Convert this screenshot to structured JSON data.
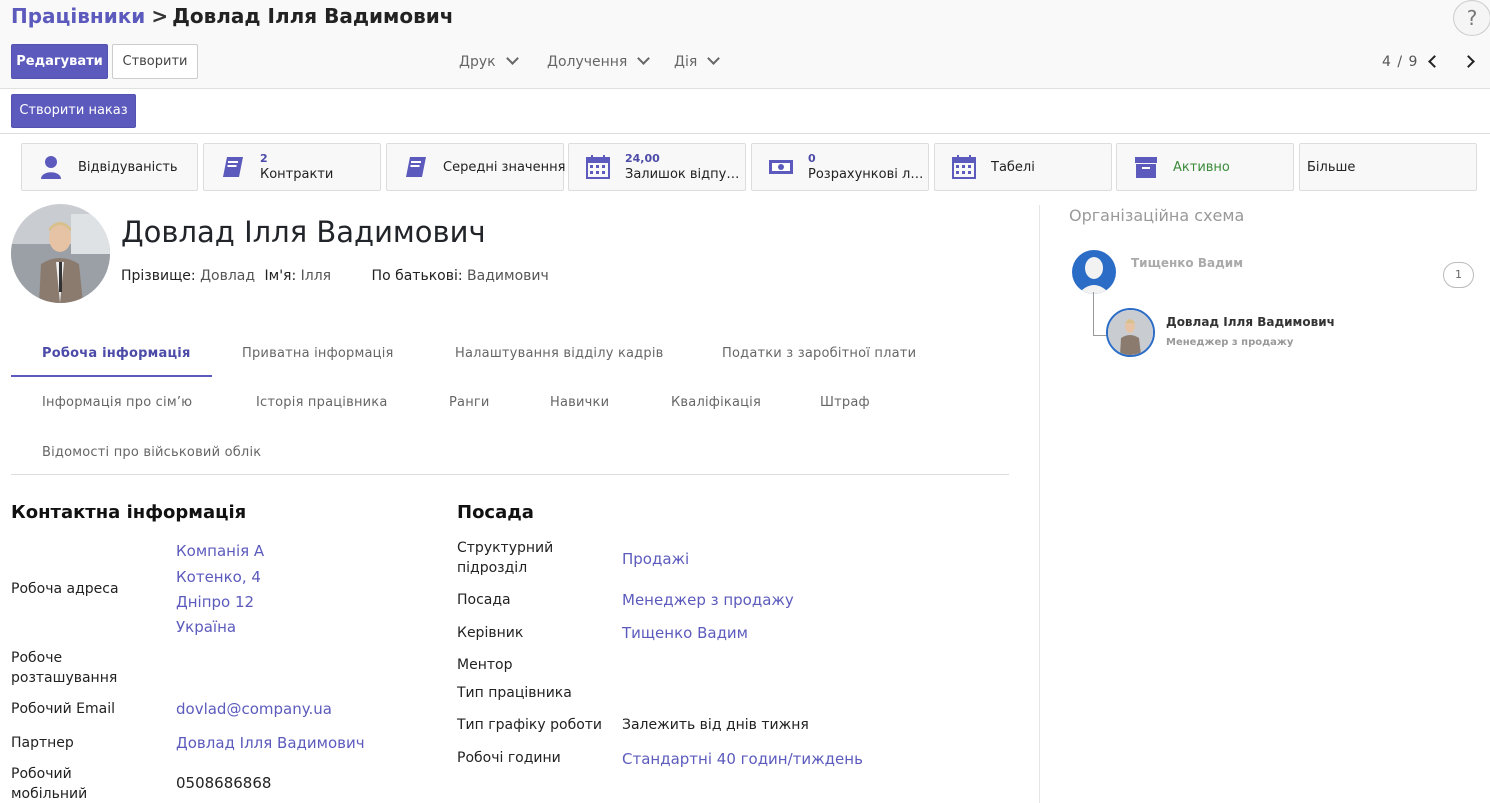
{
  "breadcrumb": {
    "parent": "Працівники",
    "separator": ">",
    "current": "Довлад Ілля Вадимович"
  },
  "help_label": "?",
  "toolbar": {
    "edit_label": "Редагувати",
    "create_label": "Створити",
    "print_label": "Друк",
    "attach_label": "Долучення",
    "action_label": "Дія"
  },
  "pager": {
    "value": "4 / 9"
  },
  "statusbar": {
    "create_order_label": "Створити наказ"
  },
  "smart_buttons": [
    {
      "label": "Відвідуваність",
      "icon": "user-icon"
    },
    {
      "count": "2",
      "label": "Контракти",
      "icon": "book-icon"
    },
    {
      "label": "Середні значення",
      "icon": "book-icon"
    },
    {
      "count": "24,00",
      "label": "Залишок відпуст…",
      "icon": "calendar-icon"
    },
    {
      "count": "0",
      "label": "Розрахункові ли…",
      "icon": "money-icon"
    },
    {
      "label": "Табелі",
      "icon": "calendar-icon"
    },
    {
      "label": "Активно",
      "icon": "archive-icon",
      "color": "#3a8b3a"
    },
    {
      "label": "Більше"
    }
  ],
  "employee": {
    "name": "Довлад Ілля Вадимович",
    "surname_label": "Прізвище:",
    "surname": "Довлад",
    "firstname_label": "Ім'я:",
    "firstname": "Ілля",
    "patronymic_label": "По батькові:",
    "patronymic": "Вадимович"
  },
  "tabs": [
    "Робоча інформація",
    "Приватна інформація",
    "Налаштування відділу кадрів",
    "Податки з заробітної плати",
    "Інформація про сім’ю",
    "Історія працівника",
    "Ранги",
    "Навички",
    "Кваліфікація",
    "Штраф",
    "Відомості про військовий облік"
  ],
  "contact": {
    "title": "Контактна інформація",
    "work_address_label": "Робоча адреса",
    "work_address": [
      "Компанія А",
      "Котенко, 4",
      "Дніпро 12",
      "Україна"
    ],
    "work_location_label": "Робоче розташування",
    "work_email_label": "Робочий Email",
    "work_email": "dovlad@company.ua",
    "partner_label": "Партнер",
    "partner": "Довлад Ілля Вадимович",
    "mobile_label": "Робочий мобільний",
    "mobile": "0508686868"
  },
  "position": {
    "title": "Посада",
    "department_label": "Структурний підрозділ",
    "department": "Продажі",
    "job_label": "Посада",
    "job": "Менеджер з продажу",
    "manager_label": "Керівник",
    "manager": "Тищенко Вадим",
    "mentor_label": "Ментор",
    "employee_type_label": "Тип працівника",
    "schedule_type_label": "Тип графіку роботи",
    "schedule_type": "Залежить від днів тижня",
    "working_hours_label": "Робочі години",
    "working_hours": "Стандартні 40 годин/тиждень"
  },
  "org_chart": {
    "title": "Організаційна схема",
    "manager_name": "Тищенко Вадим",
    "manager_count": "1",
    "employee_name": "Довлад Ілля Вадимович",
    "employee_job": "Менеджер з продажу"
  },
  "colors": {
    "accent": "#5c5bbd",
    "link": "#5c5bbd",
    "active_status": "#3a8b3a"
  }
}
